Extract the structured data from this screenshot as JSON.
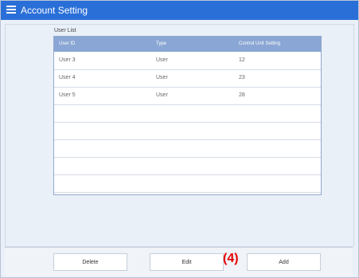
{
  "window": {
    "title": "Account Setting",
    "menu_icon": "hamburger-menu-icon"
  },
  "user_list": {
    "label": "User List",
    "columns": [
      "User ID",
      "Type",
      "Control Unit Setting"
    ],
    "rows": [
      [
        "User 3",
        "User",
        "12"
      ],
      [
        "User 4",
        "User",
        "23"
      ],
      [
        "User 5",
        "User",
        "28"
      ]
    ]
  },
  "actions": {
    "delete": "Delete",
    "edit": "Edit",
    "add": "Add"
  },
  "annotation": "(4)",
  "colors": {
    "titlebar": "#2a6fd8",
    "header": "#8aa6d4",
    "callout": "#e30000"
  }
}
